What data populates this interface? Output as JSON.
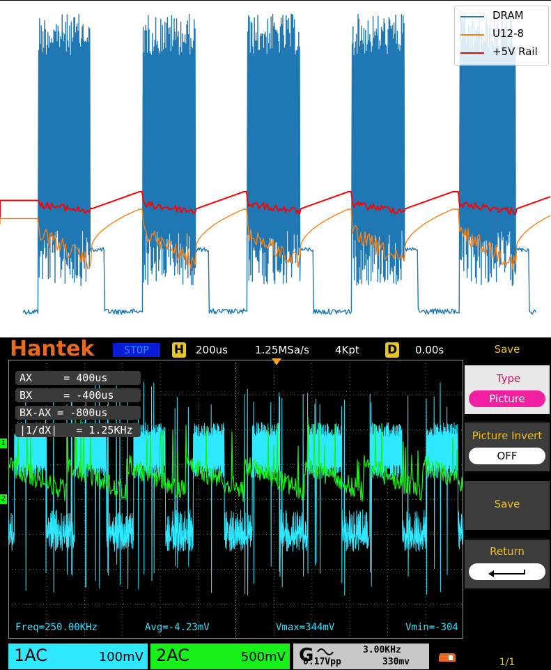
{
  "chart_data": {
    "type": "line",
    "title": "",
    "xlabel": "",
    "ylabel": "",
    "series": [
      {
        "name": "DRAM",
        "color": "#1f77b4"
      },
      {
        "name": "U12-8",
        "color": "#ff7f0e"
      },
      {
        "name": "+5V Rail",
        "color": "#ff0000"
      }
    ],
    "legend_position": "top-right",
    "grid": false
  },
  "scope": {
    "brand": "Hantek",
    "status": "STOP",
    "timebase_badge": "H",
    "timebase": "200us",
    "sample_rate": "1.25MSa/s",
    "memory_depth": "4Kpt",
    "delay_badge": "D",
    "delay": "0.00s",
    "cursors": {
      "ax": "AX     = 400us",
      "bx": "BX     = -400us",
      "bxax": "BX-AX = -800us",
      "inv": "|1/dX|   = 1.25KHz"
    },
    "measurements": {
      "freq": "Freq=250.00KHz",
      "avg": "Avg=-4.23mV",
      "vmax": "Vmax=344mV",
      "vmin": "Vmin=-304"
    },
    "ch1": {
      "label": "1AC",
      "scale": "100mV",
      "color": "#2ee8ff"
    },
    "ch2": {
      "label": "2AC",
      "scale": "500mV",
      "color": "#18f01a"
    },
    "generator": {
      "label": "G",
      "freq": "3.00KHz",
      "amp": "0.17Vpp",
      "offset": "330mv"
    },
    "ch_markers": {
      "ch1": "1",
      "ch2": "2"
    }
  },
  "menu": {
    "title": "Save",
    "type_label": "Type",
    "type_value": "Picture",
    "invert_label": "Picture Invert",
    "invert_value": "OFF",
    "save_label": "Save",
    "return_label": "Return",
    "page": "1/1"
  }
}
